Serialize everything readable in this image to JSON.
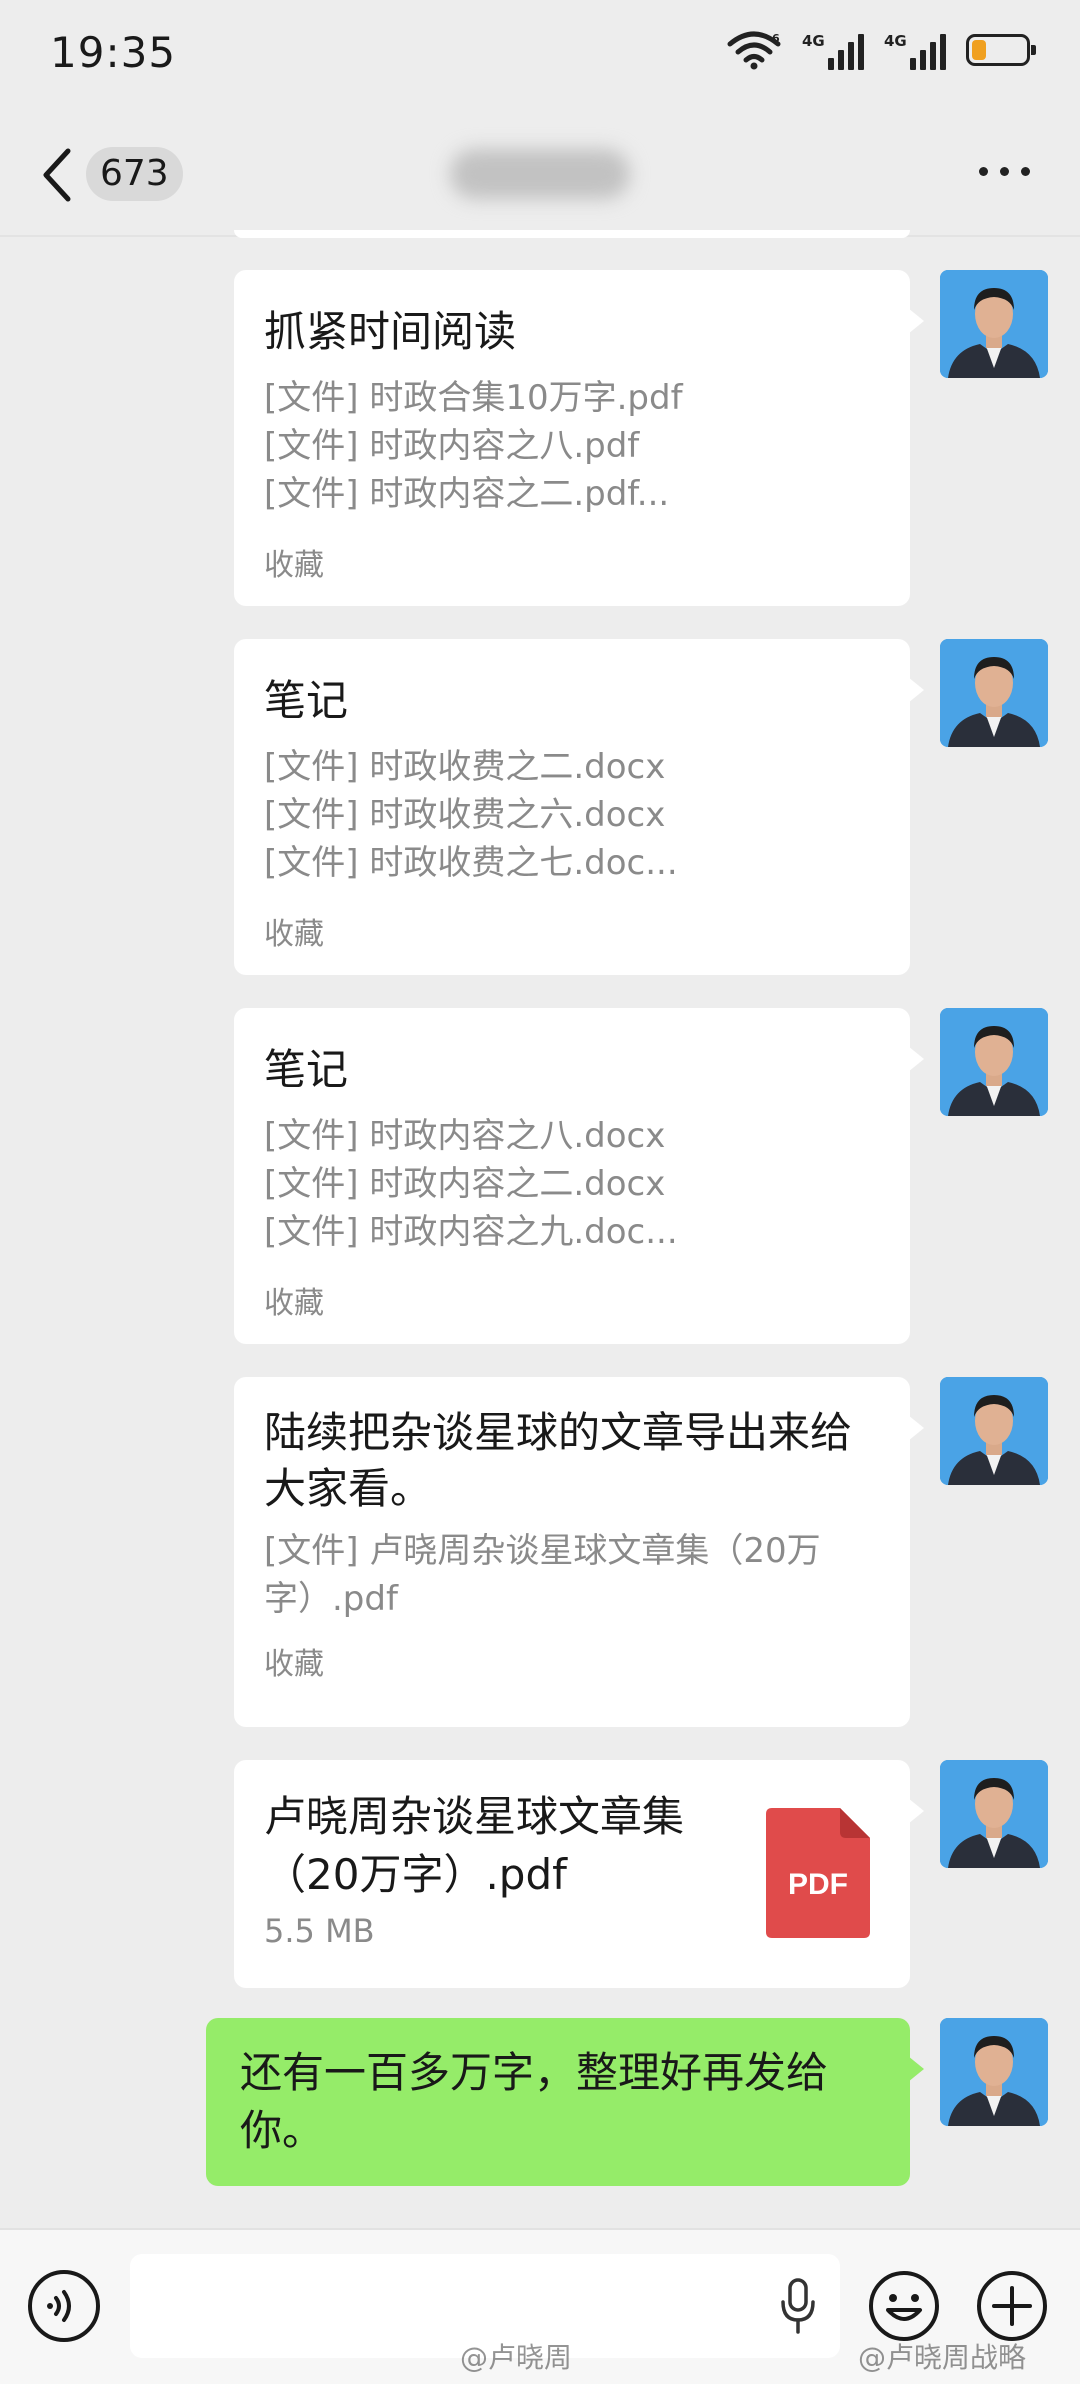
{
  "status_bar": {
    "time": "19:35",
    "icons": [
      "wifi-icon",
      "signal-4g-icon",
      "signal-4g-icon",
      "battery-low-icon"
    ],
    "network_1": "4G",
    "network_2": "4G",
    "wifi_tag": "6",
    "battery_color": "#f0a020"
  },
  "nav": {
    "back_icon": "chevron-left-icon",
    "unread_count": "673",
    "title": "",
    "more_icon": "more-dots-icon"
  },
  "messages": [
    {
      "type": "favorites_card",
      "title": "抓紧时间阅读",
      "lines": [
        "[文件] 时政合集10万字.pdf",
        "[文件] 时政内容之八.pdf",
        "[文件] 时政内容之二.pdf..."
      ],
      "footer": "收藏"
    },
    {
      "type": "favorites_card",
      "title": "笔记",
      "lines": [
        "[文件] 时政收费之二.docx",
        "[文件] 时政收费之六.docx",
        "[文件] 时政收费之七.doc..."
      ],
      "footer": "收藏"
    },
    {
      "type": "favorites_card",
      "title": "笔记",
      "lines": [
        "[文件] 时政内容之八.docx",
        "[文件] 时政内容之二.docx",
        "[文件] 时政内容之九.doc..."
      ],
      "footer": "收藏"
    },
    {
      "type": "favorites_card",
      "title": "陆续把杂谈星球的文章导出来给大家看。",
      "lines": [
        "[文件] 卢晓周杂谈星球文章集（20万字）.pdf"
      ],
      "footer": "收藏"
    },
    {
      "type": "file",
      "name": "卢晓周杂谈星球文章集（20万字）.pdf",
      "size": "5.5 MB",
      "icon_label": "PDF",
      "icon_color": "#e04b4b"
    },
    {
      "type": "text",
      "text": "还有一百多万字，整理好再发给你。",
      "bubble_color": "#95ec69"
    }
  ],
  "input_bar": {
    "voice_icon": "voice-mode-icon",
    "mic_icon": "microphone-icon",
    "emoji_icon": "emoji-icon",
    "plus_icon": "plus-circle-icon"
  },
  "watermarks": [
    "@卢晓周",
    "@卢晓周战略"
  ]
}
